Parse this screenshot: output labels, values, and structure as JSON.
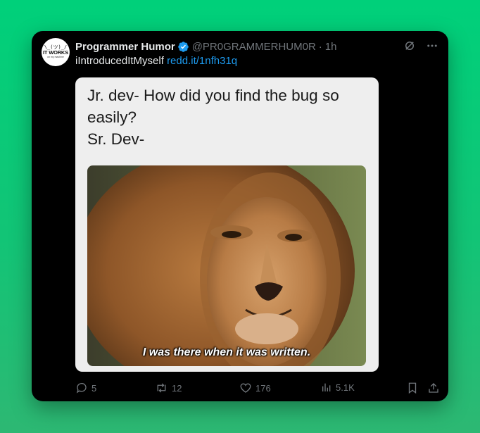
{
  "tweet": {
    "author_name": "Programmer Humor",
    "handle": "@PR0GRAMMERHUM0R",
    "separator": "·",
    "time": "1h",
    "text": "iIntroducedItMyself",
    "link": "redd.it/1nfh31q",
    "avatar": {
      "face": "\\_(ツ)_/",
      "title": "IT WORKS",
      "subtitle": "on my machine"
    }
  },
  "meme": {
    "caption_lines": [
      "Jr. dev- How did you find the bug so",
      "easily?",
      "Sr. Dev-"
    ],
    "subtitle": "I was there when it was written."
  },
  "stats": {
    "replies": "5",
    "reposts": "12",
    "likes": "176",
    "views": "5.1K"
  },
  "icons": {
    "verified": "verified-badge-icon",
    "grok": "grok-icon",
    "more": "more-icon",
    "reply": "reply-icon",
    "repost": "repost-icon",
    "like": "heart-icon",
    "views": "views-icon",
    "bookmark": "bookmark-icon",
    "share": "share-icon"
  },
  "colors": {
    "background": "#00d07a",
    "card": "#000000",
    "link": "#1d9bf0",
    "muted": "#71767b",
    "text": "#e7e9ea"
  }
}
